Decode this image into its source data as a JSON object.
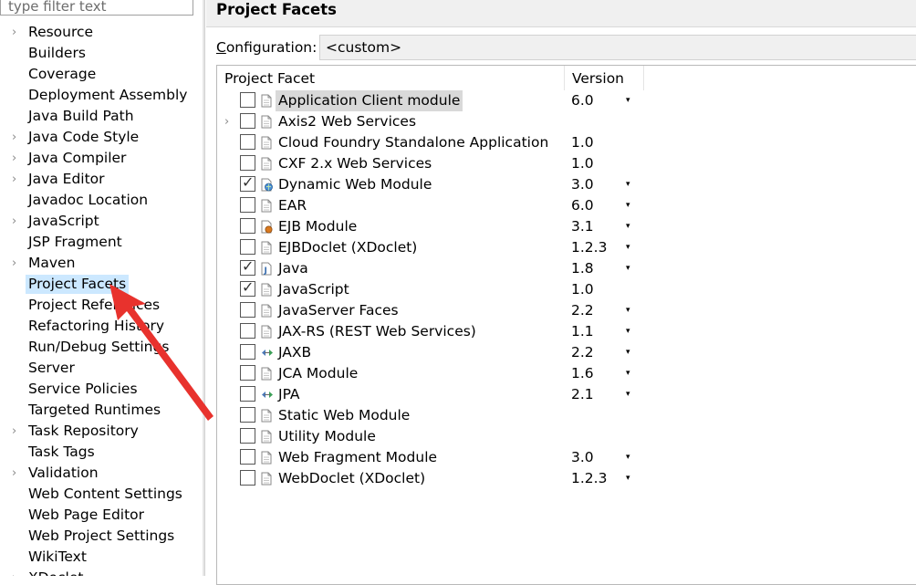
{
  "filter": {
    "placeholder": "type filter text"
  },
  "nav": {
    "items": [
      {
        "label": "Resource",
        "expandable": true
      },
      {
        "label": "Builders",
        "expandable": false
      },
      {
        "label": "Coverage",
        "expandable": false
      },
      {
        "label": "Deployment Assembly",
        "expandable": false
      },
      {
        "label": "Java Build Path",
        "expandable": false
      },
      {
        "label": "Java Code Style",
        "expandable": true
      },
      {
        "label": "Java Compiler",
        "expandable": true
      },
      {
        "label": "Java Editor",
        "expandable": true
      },
      {
        "label": "Javadoc Location",
        "expandable": false
      },
      {
        "label": "JavaScript",
        "expandable": true
      },
      {
        "label": "JSP Fragment",
        "expandable": false
      },
      {
        "label": "Maven",
        "expandable": true
      },
      {
        "label": "Project Facets",
        "expandable": false,
        "selected": true
      },
      {
        "label": "Project References",
        "expandable": false
      },
      {
        "label": "Refactoring History",
        "expandable": false
      },
      {
        "label": "Run/Debug Settings",
        "expandable": false
      },
      {
        "label": "Server",
        "expandable": false
      },
      {
        "label": "Service Policies",
        "expandable": false
      },
      {
        "label": "Targeted Runtimes",
        "expandable": false
      },
      {
        "label": "Task Repository",
        "expandable": true
      },
      {
        "label": "Task Tags",
        "expandable": false
      },
      {
        "label": "Validation",
        "expandable": true
      },
      {
        "label": "Web Content Settings",
        "expandable": false
      },
      {
        "label": "Web Page Editor",
        "expandable": false
      },
      {
        "label": "Web Project Settings",
        "expandable": false
      },
      {
        "label": "WikiText",
        "expandable": false
      },
      {
        "label": "XDoclet",
        "expandable": true
      }
    ]
  },
  "page": {
    "title": "Project Facets",
    "config_label_mnemonic": "C",
    "config_label_rest": "onfiguration:",
    "config_value": "<custom>"
  },
  "table": {
    "col_facet": "Project Facet",
    "col_version": "Version",
    "rows": [
      {
        "name": "Application Client module",
        "version": "6.0",
        "dropdown": true,
        "checked": false,
        "icon": "page-icon",
        "highlight": true
      },
      {
        "name": "Axis2 Web Services",
        "version": "",
        "dropdown": false,
        "checked": false,
        "icon": "page-icon",
        "expandable": true
      },
      {
        "name": "Cloud Foundry Standalone Application",
        "version": "1.0",
        "dropdown": false,
        "checked": false,
        "icon": "page-icon"
      },
      {
        "name": "CXF 2.x Web Services",
        "version": "1.0",
        "dropdown": false,
        "checked": false,
        "icon": "page-icon"
      },
      {
        "name": "Dynamic Web Module",
        "version": "3.0",
        "dropdown": true,
        "checked": true,
        "icon": "web-module-icon"
      },
      {
        "name": "EAR",
        "version": "6.0",
        "dropdown": true,
        "checked": false,
        "icon": "page-icon"
      },
      {
        "name": "EJB Module",
        "version": "3.1",
        "dropdown": true,
        "checked": false,
        "icon": "ejb-icon"
      },
      {
        "name": "EJBDoclet (XDoclet)",
        "version": "1.2.3",
        "dropdown": true,
        "checked": false,
        "icon": "page-icon"
      },
      {
        "name": "Java",
        "version": "1.8",
        "dropdown": true,
        "checked": true,
        "icon": "java-icon"
      },
      {
        "name": "JavaScript",
        "version": "1.0",
        "dropdown": false,
        "checked": true,
        "icon": "page-icon"
      },
      {
        "name": "JavaServer Faces",
        "version": "2.2",
        "dropdown": true,
        "checked": false,
        "icon": "page-icon"
      },
      {
        "name": "JAX-RS (REST Web Services)",
        "version": "1.1",
        "dropdown": true,
        "checked": false,
        "icon": "page-icon"
      },
      {
        "name": "JAXB",
        "version": "2.2",
        "dropdown": true,
        "checked": false,
        "icon": "arrows-icon"
      },
      {
        "name": "JCA Module",
        "version": "1.6",
        "dropdown": true,
        "checked": false,
        "icon": "page-icon"
      },
      {
        "name": "JPA",
        "version": "2.1",
        "dropdown": true,
        "checked": false,
        "icon": "arrows-icon"
      },
      {
        "name": "Static Web Module",
        "version": "",
        "dropdown": false,
        "checked": false,
        "icon": "page-icon"
      },
      {
        "name": "Utility Module",
        "version": "",
        "dropdown": false,
        "checked": false,
        "icon": "page-icon"
      },
      {
        "name": "Web Fragment Module",
        "version": "3.0",
        "dropdown": true,
        "checked": false,
        "icon": "page-icon"
      },
      {
        "name": "WebDoclet (XDoclet)",
        "version": "1.2.3",
        "dropdown": true,
        "checked": false,
        "icon": "page-icon"
      }
    ]
  },
  "colors": {
    "selection": "#cce8ff",
    "annotation_arrow": "#e8322d",
    "header_bg": "#f0f0f0"
  }
}
